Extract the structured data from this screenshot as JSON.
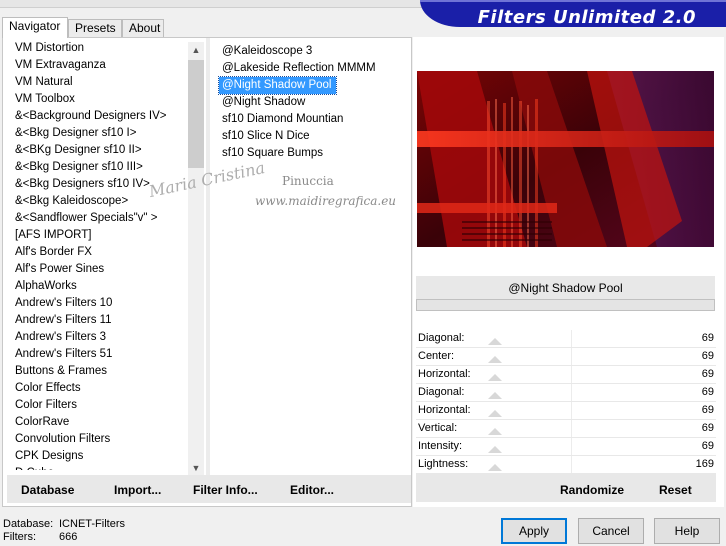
{
  "app": {
    "brand_title": "Filters Unlimited 2.0"
  },
  "tabs": [
    {
      "label": "Navigator",
      "active": true
    },
    {
      "label": "Presets",
      "active": false
    },
    {
      "label": "About",
      "active": false
    }
  ],
  "categories": [
    "VM Distortion",
    "VM Extravaganza",
    "VM Natural",
    "VM Toolbox",
    "&<Background Designers IV>",
    "&<Bkg Designer sf10 I>",
    "&<BKg Designer sf10 II>",
    "&<Bkg Designer sf10 III>",
    "&<Bkg Designers sf10 IV>",
    "&<Bkg Kaleidoscope>",
    "&<Sandflower Specials\"v\" >",
    "[AFS IMPORT]",
    "Alf's Border FX",
    "Alf's Power Sines",
    "AlphaWorks",
    "Andrew's Filters 10",
    "Andrew's Filters 11",
    "Andrew's Filters 3",
    "Andrew's Filters 51",
    "Buttons & Frames",
    "Color Effects",
    "Color Filters",
    "ColorRave",
    "Convolution Filters",
    "CPK Designs",
    "D Cube"
  ],
  "filters": [
    {
      "label": "@Kaleidoscope 3",
      "selected": false
    },
    {
      "label": "@Lakeside Reflection MMMM",
      "selected": false
    },
    {
      "label": "@Night Shadow Pool",
      "selected": true
    },
    {
      "label": "@Night Shadow",
      "selected": false
    },
    {
      "label": "sf10 Diamond Mountian",
      "selected": false
    },
    {
      "label": "sf10 Slice N Dice",
      "selected": false
    },
    {
      "label": "sf10 Square Bumps",
      "selected": false
    }
  ],
  "left_buttons": {
    "database": "Database",
    "import": "Import...",
    "filter_info": "Filter Info...",
    "editor": "Editor..."
  },
  "selected_filter_name": "@Night Shadow Pool",
  "params": [
    {
      "label": "Diagonal:",
      "value": "69"
    },
    {
      "label": "Center:",
      "value": "69"
    },
    {
      "label": "Horizontal:",
      "value": "69"
    },
    {
      "label": "Diagonal:",
      "value": "69"
    },
    {
      "label": "Horizontal:",
      "value": "69"
    },
    {
      "label": "Vertical:",
      "value": "69"
    },
    {
      "label": "Intensity:",
      "value": "69"
    },
    {
      "label": "Lightness:",
      "value": "169"
    }
  ],
  "right_buttons": {
    "randomize": "Randomize",
    "reset": "Reset"
  },
  "status": {
    "database_label": "Database:",
    "database_value": "ICNET-Filters",
    "filters_label": "Filters:",
    "filters_value": "666"
  },
  "dialog_buttons": {
    "apply": "Apply",
    "cancel": "Cancel",
    "help": "Help"
  },
  "watermark": {
    "signature": "Maria Cristina",
    "name": "Pinuccia",
    "url": "www.maidiregrafica.eu"
  },
  "colors": {
    "brand": "#1a1fa8",
    "selection": "#3399ff",
    "preview_red": "#c41a10"
  },
  "scrollbar": {
    "up_icon": "scroll-up-icon",
    "down_icon": "scroll-down-icon"
  }
}
